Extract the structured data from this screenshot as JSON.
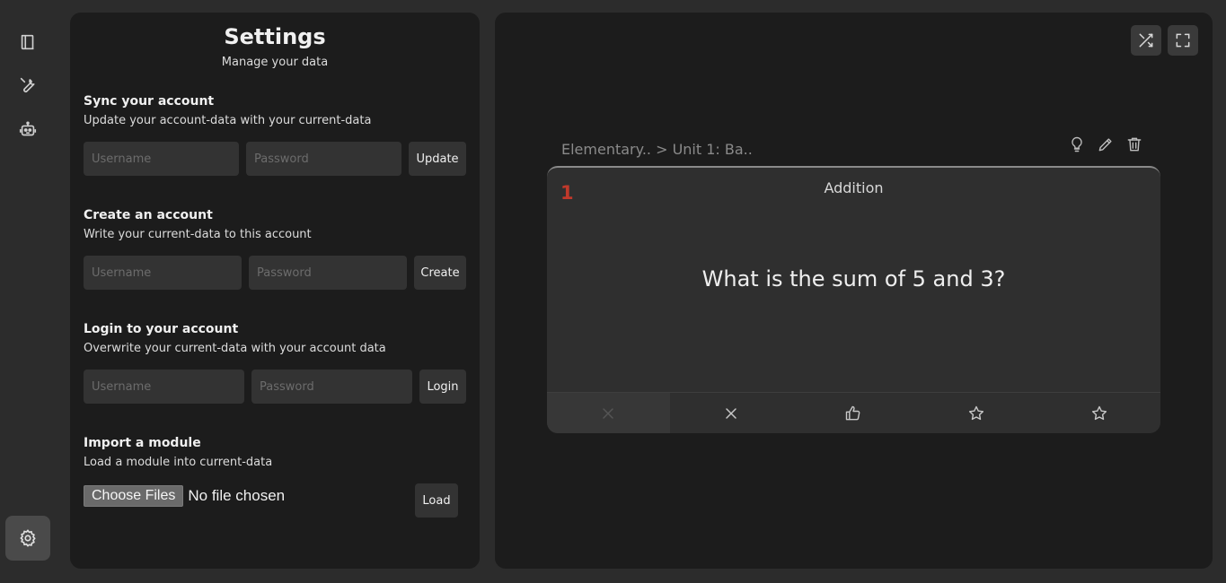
{
  "nav": {
    "items": [
      {
        "icon": "book-icon"
      },
      {
        "icon": "wrench-icon"
      },
      {
        "icon": "robot-icon"
      }
    ],
    "settings_icon": "gear-icon"
  },
  "settings": {
    "title": "Settings",
    "subtitle": "Manage your data",
    "sync": {
      "title": "Sync your account",
      "description": "Update your account-data with your current-data",
      "username_placeholder": "Username",
      "password_placeholder": "Password",
      "button": "Update"
    },
    "create": {
      "title": "Create an account",
      "description": "Write your current-data to this account",
      "username_placeholder": "Username",
      "password_placeholder": "Password",
      "button": "Create"
    },
    "login": {
      "title": "Login to your account",
      "description": "Overwrite your current-data with your account data",
      "username_placeholder": "Username",
      "password_placeholder": "Password",
      "button": "Login"
    },
    "import": {
      "title": "Import a module",
      "description": "Load a module into current-data",
      "choose_label": "Choose Files",
      "file_status": "No file chosen",
      "button": "Load"
    }
  },
  "viewer": {
    "toolbar_icons": [
      "shuffle-icon",
      "fullscreen-icon"
    ],
    "breadcrumb": "Elementary.. > Unit 1: Ba..",
    "card_tools": [
      "lightbulb-icon",
      "pencil-icon",
      "trash-icon"
    ],
    "card": {
      "number": "1",
      "title": "Addition",
      "question": "What is the sum of 5 and 3?",
      "actions": [
        "close-icon",
        "close-icon",
        "thumbs-up-icon",
        "star-icon",
        "star-icon"
      ]
    },
    "accent_color": "#c0392b"
  }
}
